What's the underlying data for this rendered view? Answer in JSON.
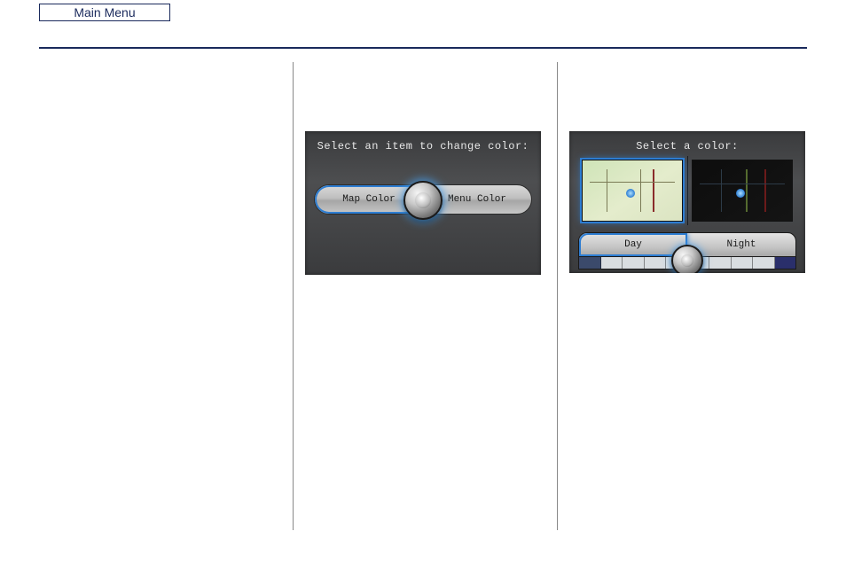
{
  "header": {
    "main_menu": "Main Menu"
  },
  "panel1": {
    "title": "Select an item to change color:",
    "option_left": "Map Color",
    "option_right": "Menu Color"
  },
  "panel2": {
    "title": "Select a color:",
    "option_left": "Day",
    "option_right": "Night",
    "swatches_left": [
      "#3b4a6b",
      "#d9dde0",
      "#d9dde0",
      "#d9dde0",
      "#d9dde0"
    ],
    "swatches_right": [
      "#d9dde0",
      "#d9dde0",
      "#d9dde0",
      "#d9dde0",
      "#2a2f6b"
    ]
  }
}
